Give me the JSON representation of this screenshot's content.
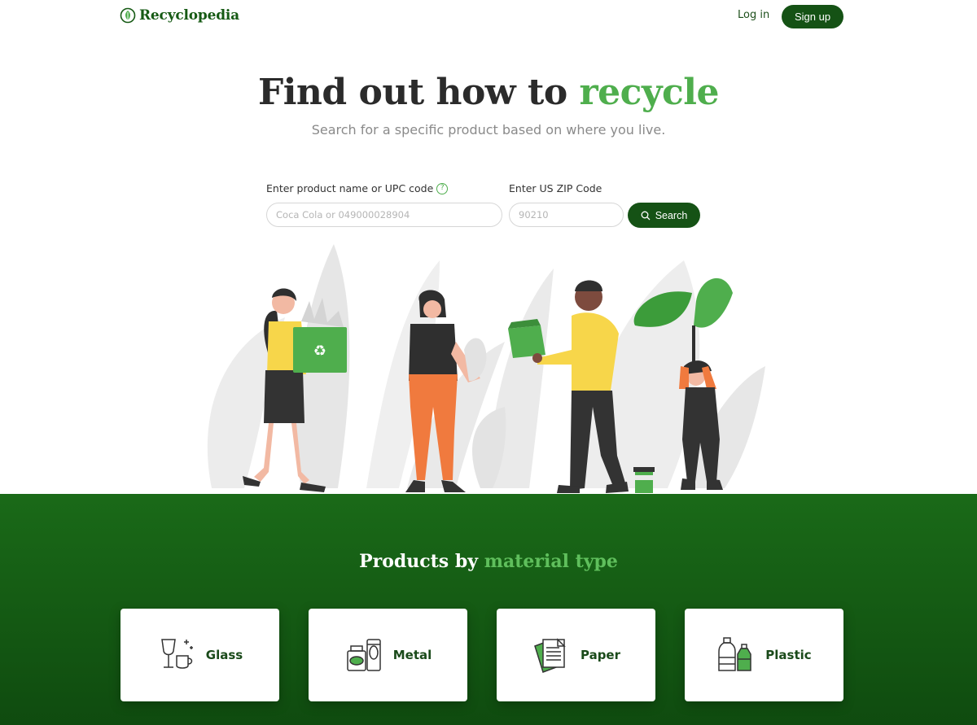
{
  "header": {
    "logo_text": "Recyclopedia",
    "login_label": "Log in",
    "signup_label": "Sign up"
  },
  "hero": {
    "title_main": "Find out how to ",
    "title_accent": "recycle",
    "subtitle": "Search for a specific product based on where you live."
  },
  "search": {
    "product_label": "Enter product name or UPC code",
    "product_placeholder": "Coca Cola or 049000028904",
    "zip_label": "Enter US ZIP Code",
    "zip_placeholder": "90210",
    "button_label": "Search"
  },
  "materials": {
    "title_main": "Products by ",
    "title_accent": "material type",
    "items": [
      {
        "label": "Glass",
        "icon": "glass-icon"
      },
      {
        "label": "Metal",
        "icon": "metal-icon"
      },
      {
        "label": "Paper",
        "icon": "paper-icon"
      },
      {
        "label": "Plastic",
        "icon": "plastic-icon"
      }
    ]
  },
  "colors": {
    "brand_dark": "#155215",
    "accent_green": "#4fae4d",
    "section_green": "#1a6a18"
  }
}
